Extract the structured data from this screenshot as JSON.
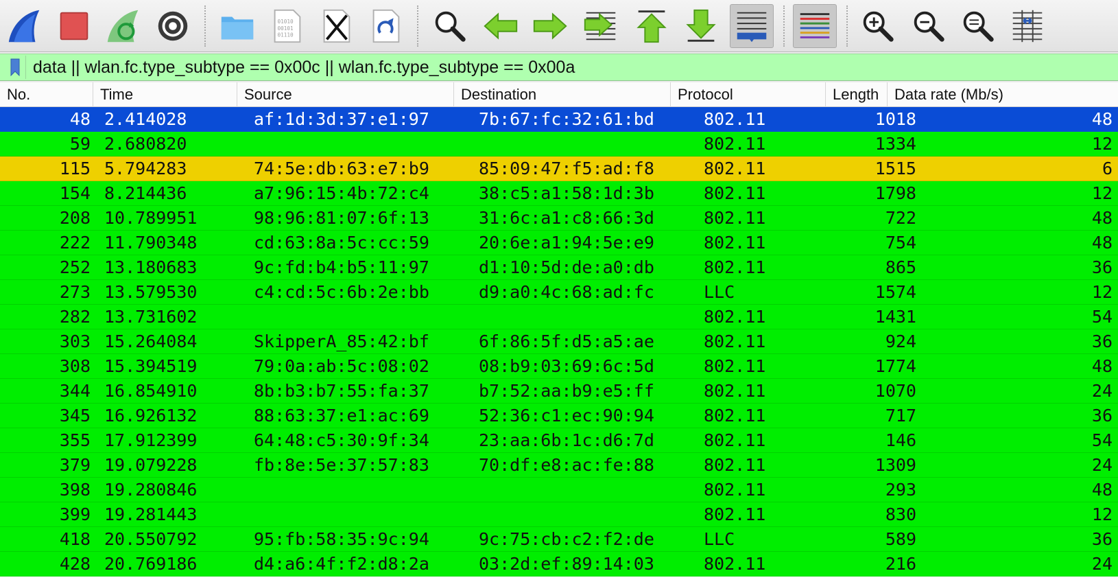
{
  "toolbar": {
    "buttons": [
      {
        "name": "start-capture-icon"
      },
      {
        "name": "stop-capture-icon"
      },
      {
        "name": "restart-capture-icon"
      },
      {
        "name": "capture-options-icon"
      },
      {
        "name": "open-file-icon"
      },
      {
        "name": "save-file-icon"
      },
      {
        "name": "close-file-icon"
      },
      {
        "name": "reload-file-icon"
      },
      {
        "name": "find-packet-icon"
      },
      {
        "name": "go-back-icon"
      },
      {
        "name": "go-forward-icon"
      },
      {
        "name": "go-to-packet-icon"
      },
      {
        "name": "go-first-packet-icon"
      },
      {
        "name": "go-last-packet-icon"
      },
      {
        "name": "auto-scroll-icon"
      },
      {
        "name": "colorize-icon"
      },
      {
        "name": "zoom-in-icon"
      },
      {
        "name": "zoom-out-icon"
      },
      {
        "name": "zoom-normal-icon"
      },
      {
        "name": "resize-columns-icon"
      }
    ]
  },
  "filter": {
    "value": "data || wlan.fc.type_subtype == 0x00c || wlan.fc.type_subtype == 0x00a",
    "background_color": "#afffaf"
  },
  "columns": [
    "No.",
    "Time",
    "Source",
    "Destination",
    "Protocol",
    "Length",
    "Data rate (Mb/s)"
  ],
  "colors": {
    "row_default": "#00ee00",
    "row_selected": "#0a4cd6",
    "row_warning": "#eed000"
  },
  "rows": [
    {
      "no": "48",
      "time": "2.414028",
      "src": "af:1d:3d:37:e1:97",
      "dst": "7b:67:fc:32:61:bd",
      "proto": "802.11",
      "len": "1018",
      "rate": "48",
      "state": "selected"
    },
    {
      "no": "59",
      "time": "2.680820",
      "src": "",
      "dst": "",
      "proto": "802.11",
      "len": "1334",
      "rate": "12",
      "state": "normal"
    },
    {
      "no": "115",
      "time": "5.794283",
      "src": "74:5e:db:63:e7:b9",
      "dst": "85:09:47:f5:ad:f8",
      "proto": "802.11",
      "len": "1515",
      "rate": "6",
      "state": "warning"
    },
    {
      "no": "154",
      "time": "8.214436",
      "src": "a7:96:15:4b:72:c4",
      "dst": "38:c5:a1:58:1d:3b",
      "proto": "802.11",
      "len": "1798",
      "rate": "12",
      "state": "normal"
    },
    {
      "no": "208",
      "time": "10.789951",
      "src": "98:96:81:07:6f:13",
      "dst": "31:6c:a1:c8:66:3d",
      "proto": "802.11",
      "len": "722",
      "rate": "48",
      "state": "normal"
    },
    {
      "no": "222",
      "time": "11.790348",
      "src": "cd:63:8a:5c:cc:59",
      "dst": "20:6e:a1:94:5e:e9",
      "proto": "802.11",
      "len": "754",
      "rate": "48",
      "state": "normal"
    },
    {
      "no": "252",
      "time": "13.180683",
      "src": "9c:fd:b4:b5:11:97",
      "dst": "d1:10:5d:de:a0:db",
      "proto": "802.11",
      "len": "865",
      "rate": "36",
      "state": "normal"
    },
    {
      "no": "273",
      "time": "13.579530",
      "src": "c4:cd:5c:6b:2e:bb",
      "dst": "d9:a0:4c:68:ad:fc",
      "proto": "LLC",
      "len": "1574",
      "rate": "12",
      "state": "normal"
    },
    {
      "no": "282",
      "time": "13.731602",
      "src": "",
      "dst": "",
      "proto": "802.11",
      "len": "1431",
      "rate": "54",
      "state": "normal"
    },
    {
      "no": "303",
      "time": "15.264084",
      "src": "SkipperA_85:42:bf",
      "dst": "6f:86:5f:d5:a5:ae",
      "proto": "802.11",
      "len": "924",
      "rate": "36",
      "state": "normal"
    },
    {
      "no": "308",
      "time": "15.394519",
      "src": "79:0a:ab:5c:08:02",
      "dst": "08:b9:03:69:6c:5d",
      "proto": "802.11",
      "len": "1774",
      "rate": "48",
      "state": "normal"
    },
    {
      "no": "344",
      "time": "16.854910",
      "src": "8b:b3:b7:55:fa:37",
      "dst": "b7:52:aa:b9:e5:ff",
      "proto": "802.11",
      "len": "1070",
      "rate": "24",
      "state": "normal"
    },
    {
      "no": "345",
      "time": "16.926132",
      "src": "88:63:37:e1:ac:69",
      "dst": "52:36:c1:ec:90:94",
      "proto": "802.11",
      "len": "717",
      "rate": "36",
      "state": "normal"
    },
    {
      "no": "355",
      "time": "17.912399",
      "src": "64:48:c5:30:9f:34",
      "dst": "23:aa:6b:1c:d6:7d",
      "proto": "802.11",
      "len": "146",
      "rate": "54",
      "state": "normal"
    },
    {
      "no": "379",
      "time": "19.079228",
      "src": "fb:8e:5e:37:57:83",
      "dst": "70:df:e8:ac:fe:88",
      "proto": "802.11",
      "len": "1309",
      "rate": "24",
      "state": "normal"
    },
    {
      "no": "398",
      "time": "19.280846",
      "src": "",
      "dst": "",
      "proto": "802.11",
      "len": "293",
      "rate": "48",
      "state": "normal"
    },
    {
      "no": "399",
      "time": "19.281443",
      "src": "",
      "dst": "",
      "proto": "802.11",
      "len": "830",
      "rate": "12",
      "state": "normal"
    },
    {
      "no": "418",
      "time": "20.550792",
      "src": "95:fb:58:35:9c:94",
      "dst": "9c:75:cb:c2:f2:de",
      "proto": "LLC",
      "len": "589",
      "rate": "36",
      "state": "normal"
    },
    {
      "no": "428",
      "time": "20.769186",
      "src": "d4:a6:4f:f2:d8:2a",
      "dst": "03:2d:ef:89:14:03",
      "proto": "802.11",
      "len": "216",
      "rate": "24",
      "state": "normal"
    }
  ]
}
